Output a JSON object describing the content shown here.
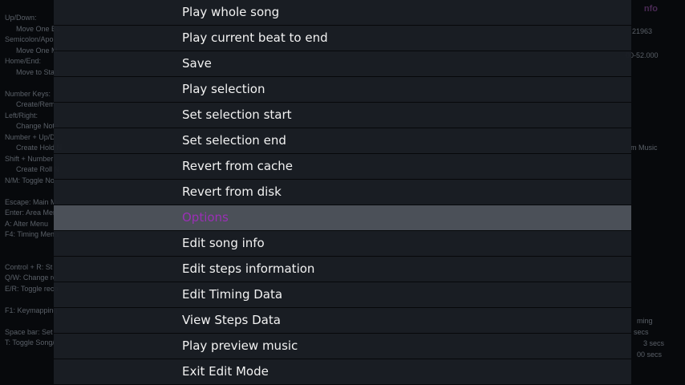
{
  "menu": {
    "items": [
      {
        "label": "Play whole song"
      },
      {
        "label": "Play current beat to end"
      },
      {
        "label": "Save"
      },
      {
        "label": "Play selection"
      },
      {
        "label": "Set selection start"
      },
      {
        "label": "Set selection end"
      },
      {
        "label": "Revert from cache"
      },
      {
        "label": "Revert from disk"
      },
      {
        "label": "Options",
        "selected": true
      },
      {
        "label": "Edit song info"
      },
      {
        "label": "Edit steps information"
      },
      {
        "label": "Edit Timing Data"
      },
      {
        "label": "View Steps Data"
      },
      {
        "label": "Play preview music"
      },
      {
        "label": "Exit Edit Mode"
      }
    ]
  },
  "background": {
    "left_lines": [
      {
        "text": "Up/Down:",
        "type": "line"
      },
      {
        "text": "Move One Be",
        "type": "ind"
      },
      {
        "text": "Semicolon/Apo",
        "type": "line"
      },
      {
        "text": "Move One M",
        "type": "ind"
      },
      {
        "text": "Home/End:",
        "type": "line"
      },
      {
        "text": "Move to Start",
        "type": "ind"
      },
      {
        "text": "",
        "type": "line"
      },
      {
        "text": "Number Keys:",
        "type": "line"
      },
      {
        "text": "Create/Rem",
        "type": "ind"
      },
      {
        "text": "Left/Right:",
        "type": "line"
      },
      {
        "text": "Change Note",
        "type": "ind"
      },
      {
        "text": "Number + Up/D",
        "type": "line"
      },
      {
        "text": "Create Hold N",
        "type": "ind"
      },
      {
        "text": "Shift + Number",
        "type": "line"
      },
      {
        "text": "Create Roll N",
        "type": "ind"
      },
      {
        "text": "N/M: Toggle No",
        "type": "line"
      },
      {
        "text": "",
        "type": "line"
      },
      {
        "text": "Escape: Main Me",
        "type": "line"
      },
      {
        "text": "Enter: Area Menu",
        "type": "line"
      },
      {
        "text": "A: Alter Menu",
        "type": "line"
      },
      {
        "text": "F4: Timing Menu",
        "type": "line"
      },
      {
        "text": "",
        "type": "line"
      },
      {
        "text": "",
        "type": "line"
      },
      {
        "text": "Control + R: St",
        "type": "line"
      },
      {
        "text": "Q/W: Change re",
        "type": "line"
      },
      {
        "text": "E/R: Toggle reco",
        "type": "line"
      },
      {
        "text": "",
        "type": "line"
      },
      {
        "text": "F1: Keymapping",
        "type": "line"
      },
      {
        "text": "",
        "type": "line"
      },
      {
        "text": "Space bar: Set",
        "type": "line"
      },
      {
        "text": "T: Toggle Song/",
        "type": "line"
      }
    ],
    "info_title": "nfo",
    "right_lines": [
      {
        "text": "21963"
      },
      {
        "text": "00-52.000"
      },
      {
        "text": "m Music"
      },
      {
        "text": "ming"
      },
      {
        "text": "secs"
      },
      {
        "text": "3 secs"
      },
      {
        "text": "00 secs"
      }
    ]
  }
}
